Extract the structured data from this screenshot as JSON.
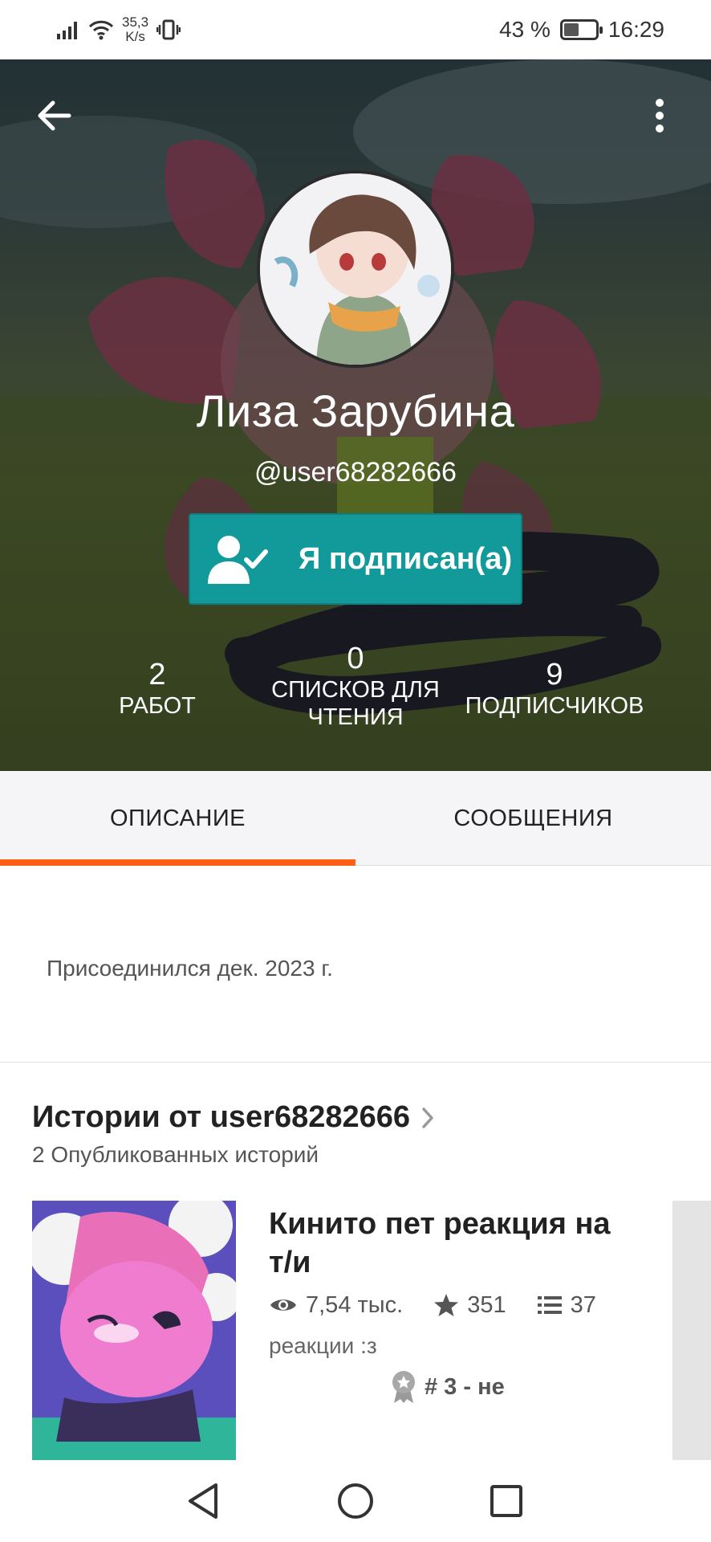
{
  "status_bar": {
    "net_speed_value": "35,3",
    "net_speed_unit": "K/s",
    "battery": "43 %",
    "time": "16:29"
  },
  "profile": {
    "name": "Лиза Зарубина",
    "handle": "@user68282666",
    "follow_label": "Я подписан(а)",
    "stats": [
      {
        "value": "2",
        "label": "РАБОТ"
      },
      {
        "value": "0",
        "label": "СПИСКОВ ДЛЯ ЧТЕНИЯ"
      },
      {
        "value": "9",
        "label": "ПОДПИСЧИКОВ"
      }
    ]
  },
  "tabs": [
    {
      "label": "ОПИСАНИЕ",
      "active": true
    },
    {
      "label": "СООБЩЕНИЯ",
      "active": false
    }
  ],
  "about": {
    "joined": "Присоединился дек. 2023 г."
  },
  "stories": {
    "title": "Истории от user68282666",
    "subtitle": "2 Опубликованных историй",
    "items": [
      {
        "title": "Кинито пет реакция на т/и",
        "reads": "7,54 тыс.",
        "votes": "351",
        "parts": "37",
        "description": "реакции :з",
        "rank": "# 3 - не"
      }
    ]
  },
  "colors": {
    "accent": "#ff6015",
    "follow_button": "#12999a"
  },
  "icons": {
    "back": "arrow-left-icon",
    "menu": "more-vertical-icon",
    "follow": "user-check-icon",
    "reads": "eye-icon",
    "votes": "star-icon",
    "parts": "list-icon",
    "rank": "award-icon"
  }
}
